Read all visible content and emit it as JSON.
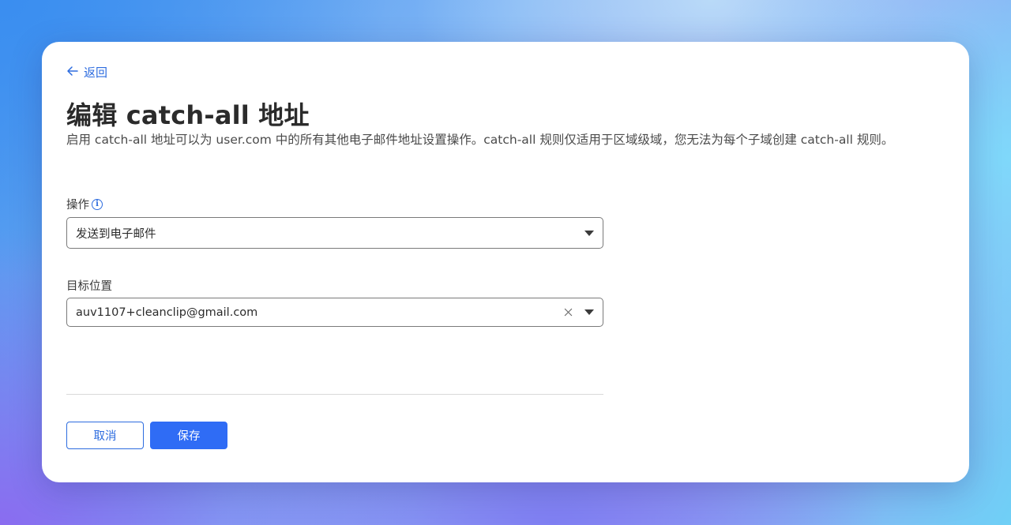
{
  "header": {
    "back_label": "返回",
    "title": "编辑 catch-all 地址",
    "description": "启用 catch-all 地址可以为 user.com 中的所有其他电子邮件地址设置操作。catch-all 规则仅适用于区域级域，您无法为每个子域创建 catch-all 规则。"
  },
  "form": {
    "action": {
      "label": "操作",
      "info_icon": "i",
      "selected": "发送到电子邮件"
    },
    "destination": {
      "label": "目标位置",
      "value": "auv1107+cleanclip@gmail.com"
    }
  },
  "buttons": {
    "cancel_label": "取消",
    "save_label": "保存"
  },
  "colors": {
    "accent": "#2d6cdf",
    "primary_button": "#2f6cf5"
  },
  "icons": {
    "back": "arrow-left-icon",
    "info": "info-circle-icon",
    "clear": "close-icon",
    "dropdown": "caret-down-icon"
  }
}
